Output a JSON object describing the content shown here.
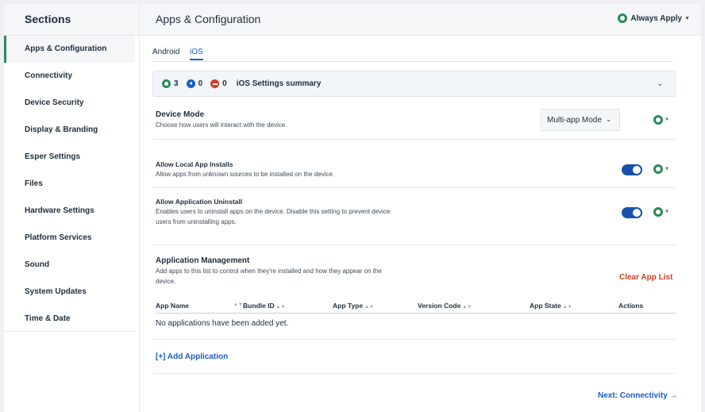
{
  "sidebar": {
    "title": "Sections",
    "items": [
      {
        "label": "Apps & Configuration"
      },
      {
        "label": "Connectivity"
      },
      {
        "label": "Device Security"
      },
      {
        "label": "Display & Branding"
      },
      {
        "label": "Esper Settings"
      },
      {
        "label": "Files"
      },
      {
        "label": "Hardware Settings"
      },
      {
        "label": "Platform Services"
      },
      {
        "label": "Sound"
      },
      {
        "label": "System Updates"
      },
      {
        "label": "Time & Date"
      }
    ],
    "active_index": 0
  },
  "header": {
    "title": "Apps & Configuration",
    "apply_label": "Always Apply"
  },
  "tabs": [
    {
      "label": "Android"
    },
    {
      "label": "iOS"
    }
  ],
  "active_tab": "iOS",
  "summary": {
    "applied_count": "3",
    "skipped_count": "0",
    "blocked_count": "0",
    "title": "iOS Settings summary"
  },
  "device_mode": {
    "label": "Device Mode",
    "description": "Choose how users will interact with the device.",
    "selected": "Multi-app Mode"
  },
  "local_installs": {
    "label": "Allow Local App Installs",
    "description": "Allow apps from unknown sources to be installed on the device.",
    "enabled": true
  },
  "app_uninstall": {
    "label": "Allow Application Uninstall",
    "description_line1": "Enables users to uninstall apps on the device. Disable this setting to prevent device",
    "description_line2": "users from uninstalling apps.",
    "enabled": true
  },
  "app_management": {
    "label": "Application Management",
    "description_line1": "Add apps to this list to control when they're installed and how they appear on the",
    "description_line2": "device.",
    "clear_label": "Clear App List",
    "columns": [
      "App Name",
      "Bundle ID",
      "App Type",
      "Version Code",
      "App State",
      "Actions"
    ],
    "empty_text": "No applications have been added yet.",
    "add_label": "[+] Add Application"
  },
  "footer": {
    "next_label": "Next: Connectivity →"
  },
  "colors": {
    "accent_green": "#2b8a5b",
    "link_blue": "#1a5dc8",
    "danger_red": "#d63b1f"
  }
}
